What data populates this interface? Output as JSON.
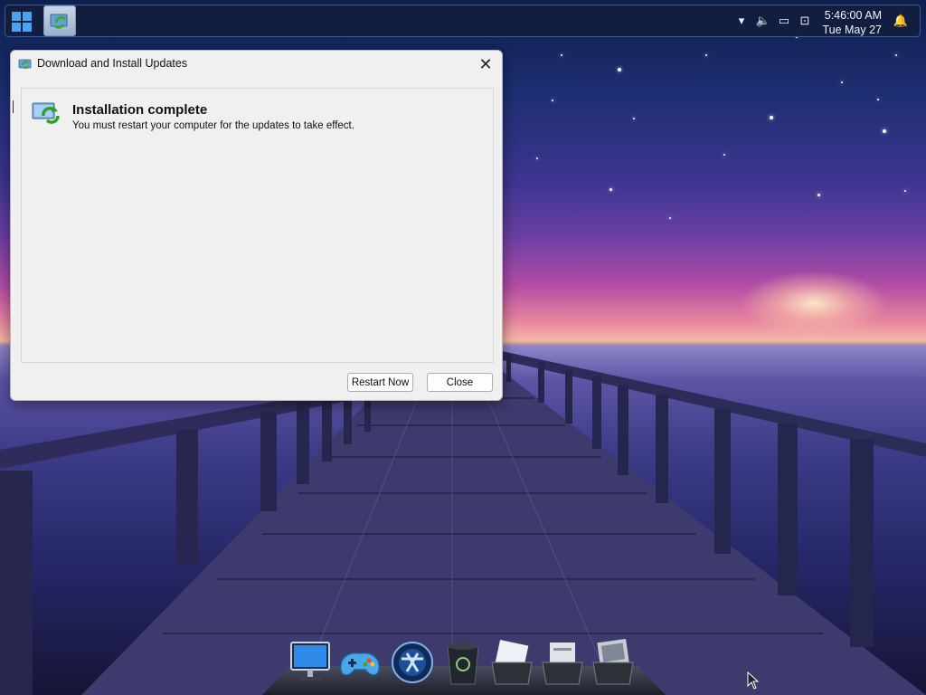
{
  "taskbar": {
    "start_icon": "windows-logo-icon",
    "active_app_icon": "windows-update-icon",
    "tray_icons": [
      "chevron-up-icon",
      "volume-icon",
      "battery-icon",
      "network-icon",
      "notification-bell-icon"
    ],
    "clock_time": "5:46:00 AM",
    "clock_date": "Tue May 27"
  },
  "dialog": {
    "title": "Download and Install Updates",
    "heading": "Installation complete",
    "message": "You must restart your computer for the updates to take effect.",
    "restart_label": "Restart Now",
    "close_label": "Close"
  },
  "dock": {
    "items": [
      "computer-icon",
      "game-controller-icon",
      "internet-explorer-icon",
      "trash-icon",
      "mail-folder-icon",
      "documents-folder-icon",
      "pictures-folder-icon"
    ]
  },
  "colors": {
    "taskbar_bg": "#121e3e",
    "dialog_bg": "#f0f0f0",
    "accent_green": "#3aa835",
    "accent_blue": "#2f7fd8"
  }
}
